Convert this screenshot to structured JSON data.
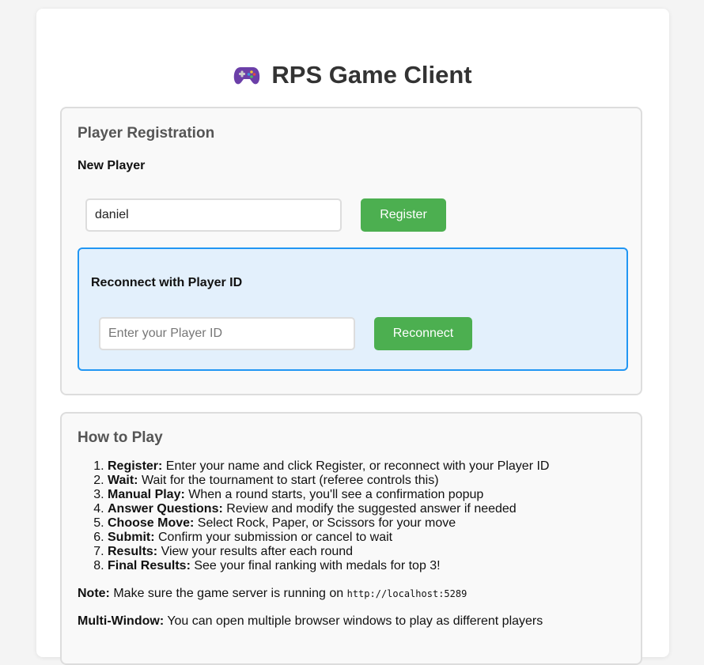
{
  "header": {
    "title": "RPS Game Client",
    "icon": "gamepad-icon"
  },
  "registration": {
    "heading": "Player Registration",
    "new_player_label": "New Player",
    "name_input_value": "daniel",
    "register_label": "Register",
    "reconnect_heading": "Reconnect with Player ID",
    "player_id_placeholder": "Enter your Player ID",
    "player_id_value": "",
    "reconnect_label": "Reconnect"
  },
  "how_to_play": {
    "heading": "How to Play",
    "steps": [
      {
        "term": "Register:",
        "text": " Enter your name and click Register, or reconnect with your Player ID"
      },
      {
        "term": "Wait:",
        "text": " Wait for the tournament to start (referee controls this)"
      },
      {
        "term": "Manual Play:",
        "text": " When a round starts, you'll see a confirmation popup"
      },
      {
        "term": "Answer Questions:",
        "text": " Review and modify the suggested answer if needed"
      },
      {
        "term": "Choose Move:",
        "text": " Select Rock, Paper, or Scissors for your move"
      },
      {
        "term": "Submit:",
        "text": " Confirm your submission or cancel to wait"
      },
      {
        "term": "Results:",
        "text": " View your results after each round"
      },
      {
        "term": "Final Results:",
        "text": " See your final ranking with medals for top 3!"
      }
    ],
    "note_term": "Note:",
    "note_text": " Make sure the game server is running on ",
    "note_code": "http://localhost:5289",
    "multi_term": "Multi-Window:",
    "multi_text": " You can open multiple browser windows to play as different players"
  },
  "colors": {
    "accent_green": "#4caf50",
    "reconnect_border": "#2196f3",
    "reconnect_bg": "#e3f0fc"
  }
}
